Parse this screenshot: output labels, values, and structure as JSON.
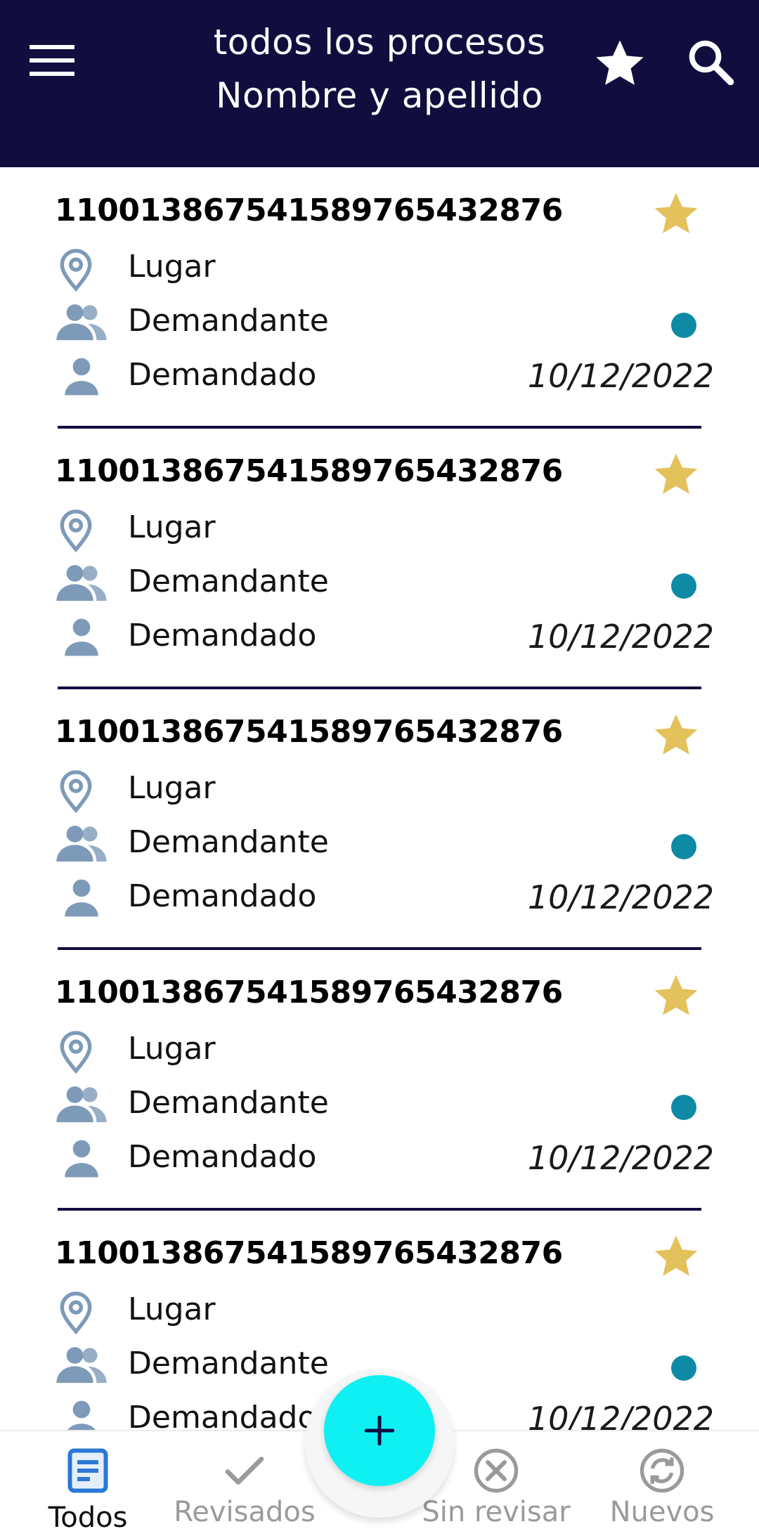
{
  "header": {
    "title_line1": "todos los procesos",
    "title_line2": "Nombre y apellido",
    "menu_icon": "menu-icon",
    "favorite_icon": "star-icon",
    "search_icon": "search-icon"
  },
  "colors": {
    "header_bg": "#110d3f",
    "star_gold": "#e3c15b",
    "icon_blue_gray": "#7e9ab9",
    "status_dot": "#0e8aa6",
    "fab": "#0ff0f2",
    "nav_active": "#2b78d6",
    "nav_inactive": "#9a9a9a"
  },
  "processes": [
    {
      "number": "11001386754158976543287​6",
      "place": "Lugar",
      "plaintiff": "Demandante",
      "defendant": "Demandado",
      "date": "10/12/2022",
      "favorite": true,
      "has_update": true
    },
    {
      "number": "110013867541589765432876",
      "place": "Lugar",
      "plaintiff": "Demandante",
      "defendant": "Demandado",
      "date": "10/12/2022",
      "favorite": true,
      "has_update": true
    },
    {
      "number": "110013867541589765432876",
      "place": "Lugar",
      "plaintiff": "Demandante",
      "defendant": "Demandado",
      "date": "10/12/2022",
      "favorite": true,
      "has_update": true
    },
    {
      "number": "110013867541589765432876",
      "place": "Lugar",
      "plaintiff": "Demandante",
      "defendant": "Demandado",
      "date": "10/12/2022",
      "favorite": true,
      "has_update": true
    },
    {
      "number": "110013867541589765432876",
      "place": "Lugar",
      "plaintiff": "Demandante",
      "defendant": "Demandado",
      "date": "10/12/2022",
      "favorite": true,
      "has_update": true
    }
  ],
  "fab": {
    "label": "+",
    "icon": "plus-icon"
  },
  "bottom_nav": [
    {
      "label": "Todos",
      "icon": "document-icon",
      "active": true
    },
    {
      "label": "Revisados",
      "icon": "check-icon",
      "active": false
    },
    {
      "label": "Sin revisar",
      "icon": "close-circle-icon",
      "active": false
    },
    {
      "label": "Nuevos",
      "icon": "sync-icon",
      "active": false
    }
  ]
}
